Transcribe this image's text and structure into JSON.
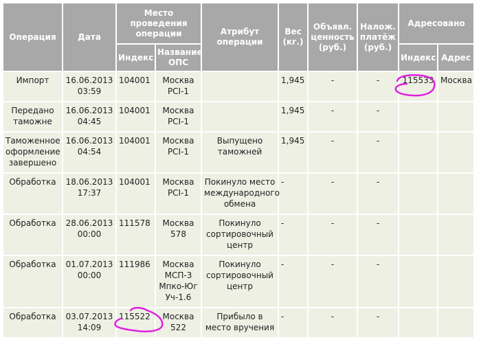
{
  "table": {
    "headers": {
      "operation": "Операция",
      "date": "Дата",
      "place": "Место проведения операции",
      "index": "Индекс",
      "ops_name": "Название ОПС",
      "attribute": "Атрибут операции",
      "weight": "Вес (кг.)",
      "declared_value": "Объявл. ценность (руб.)",
      "cod": "Налож. платёж (руб.)",
      "addressed": "Адресовано",
      "addr_index": "Индекс",
      "addr_address": "Адрес"
    },
    "rows": [
      {
        "operation": "Импорт",
        "date": "16.06.2013\n03:59",
        "index": "104001",
        "ops_name": "Москва\nPCI-1",
        "attribute": "",
        "weight": "1,945",
        "declared_value": "-",
        "cod": "-",
        "addr_index": "115533",
        "addr_address": "Москва"
      },
      {
        "operation": "Передано\nтаможне",
        "date": "16.06.2013\n04:45",
        "index": "104001",
        "ops_name": "Москва\nPCI-1",
        "attribute": "",
        "weight": "1,945",
        "declared_value": "-",
        "cod": "-",
        "addr_index": "",
        "addr_address": ""
      },
      {
        "operation": "Таможенное\nоформление\nзавершено",
        "date": "16.06.2013\n04:54",
        "index": "104001",
        "ops_name": "Москва\nPCI-1",
        "attribute": "Выпущено\nтаможней",
        "weight": "1,945",
        "declared_value": "-",
        "cod": "-",
        "addr_index": "",
        "addr_address": ""
      },
      {
        "operation": "Обработка",
        "date": "18.06.2013\n17:37",
        "index": "104001",
        "ops_name": "Москва\nPCI-1",
        "attribute": "Покинуло место\nмеждународного\nобмена",
        "weight": "-",
        "declared_value": "-",
        "cod": "-",
        "addr_index": "",
        "addr_address": ""
      },
      {
        "operation": "Обработка",
        "date": "28.06.2013\n00:00",
        "index": "111578",
        "ops_name": "Москва\n578",
        "attribute": "Покинуло\nсортировочный\nцентр",
        "weight": "-",
        "declared_value": "-",
        "cod": "-",
        "addr_index": "",
        "addr_address": ""
      },
      {
        "operation": "Обработка",
        "date": "01.07.2013\n00:00",
        "index": "111986",
        "ops_name": "Москва\nМСП-3\nМпко-Юг\nУч-1.6",
        "attribute": "Покинуло\nсортировочный\nцентр",
        "weight": "-",
        "declared_value": "-",
        "cod": "-",
        "addr_index": "",
        "addr_address": ""
      },
      {
        "operation": "Обработка",
        "date": "03.07.2013\n14:09",
        "index": "115522",
        "ops_name": "Москва\n522",
        "attribute": "Прибыло в\nместо вручения",
        "weight": "-",
        "declared_value": "-",
        "cod": "-",
        "addr_index": "",
        "addr_address": ""
      }
    ]
  },
  "colors": {
    "header_bg": "#a8a8a8",
    "cell_bg": "#eef0e4",
    "annotation": "#e020e0"
  }
}
